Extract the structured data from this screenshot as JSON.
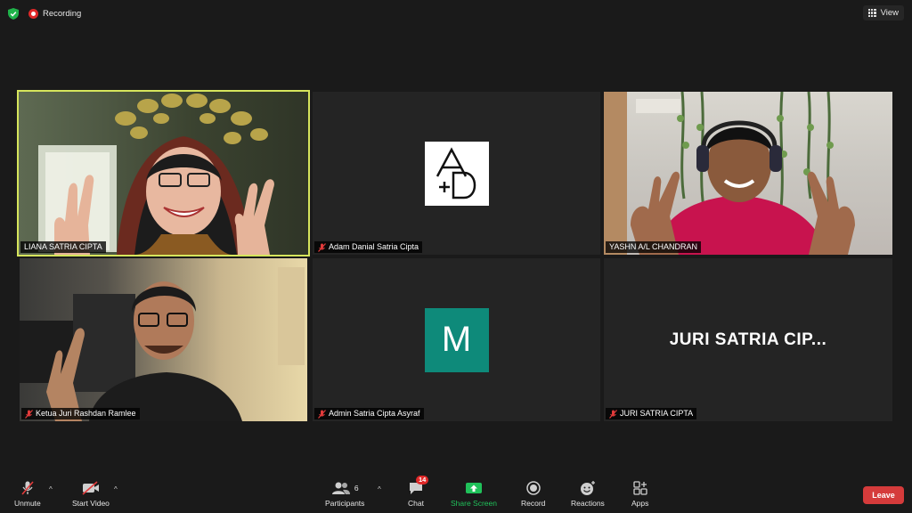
{
  "topbar": {
    "recording_label": "Recording",
    "view_label": "View"
  },
  "tiles": [
    {
      "name": "LIANA SATRIA CIPTA",
      "muted": false,
      "active_speaker": true
    },
    {
      "name": "Adam Danial Satria Cipta",
      "muted": true,
      "avatar": "A+D"
    },
    {
      "name": "YASHN A/L CHANDRAN",
      "muted": false
    },
    {
      "name": "Ketua Juri Rashdan Ramlee",
      "muted": true
    },
    {
      "name": "Admin Satria Cipta Asyraf",
      "muted": true,
      "avatar_letter": "M"
    },
    {
      "name": "JURI SATRIA CIPTA",
      "muted": true,
      "display_text": "JURI SATRIA CIP..."
    }
  ],
  "toolbar": {
    "unmute_label": "Unmute",
    "start_video_label": "Start Video",
    "participants_label": "Participants",
    "participants_count": "6",
    "chat_label": "Chat",
    "chat_badge": "14",
    "share_screen_label": "Share Screen",
    "record_label": "Record",
    "reactions_label": "Reactions",
    "apps_label": "Apps",
    "leave_label": "Leave"
  },
  "colors": {
    "background": "#1a1a1a",
    "active_border": "#d6e55c",
    "share_green": "#20c15a",
    "leave_red": "#d53b3b",
    "avatar_teal": "#0e8a7a"
  }
}
